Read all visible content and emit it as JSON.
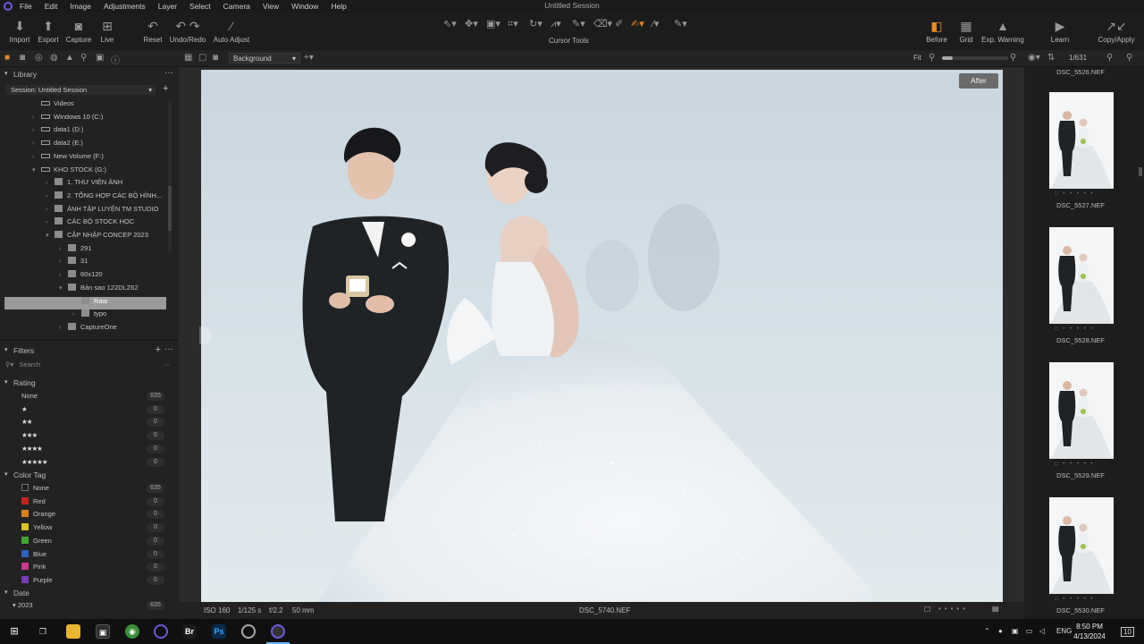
{
  "menu": [
    "File",
    "Edit",
    "Image",
    "Adjustments",
    "Layer",
    "Select",
    "Camera",
    "View",
    "Window",
    "Help"
  ],
  "window_title": "Untitled Session",
  "toolbar": {
    "import": "Import",
    "export": "Export",
    "capture": "Capture",
    "live": "Live",
    "reset": "Reset",
    "undo_redo": "Undo/Redo",
    "auto_adjust": "Auto Adjust",
    "cursor_tools": "Cursor Tools",
    "before": "Before",
    "grid": "Grid",
    "exp_warning": "Exp. Warning",
    "learn": "Learn",
    "copy_apply": "Copy/Apply"
  },
  "viewer_toolbar": {
    "background": "Background",
    "fit": "Fit",
    "counter": "1/631"
  },
  "library": {
    "title": "Library",
    "session": "Session: Untitled Session",
    "tree": [
      {
        "label": "Videos",
        "level": 0
      },
      {
        "label": "Windows 10 (C:)",
        "level": 0
      },
      {
        "label": "data1 (D:)",
        "level": 0
      },
      {
        "label": "data2 (E:)",
        "level": 0
      },
      {
        "label": "New Volume (F:)",
        "level": 0
      },
      {
        "label": "KHO STOCK (G:)",
        "level": 0
      },
      {
        "label": "1. THƯ VIỆN ẢNH",
        "level": 1
      },
      {
        "label": "2. TỔNG HỢP CÁC BỘ HÌNH...",
        "level": 1
      },
      {
        "label": "ẢNH TẬP LUYỆN TM STUDIO",
        "level": 1
      },
      {
        "label": "CÁC BỘ STOCK HỌC",
        "level": 1
      },
      {
        "label": "CẬP NHẬP CONCEP 2023",
        "level": 1
      },
      {
        "label": "291",
        "level": 2
      },
      {
        "label": "31",
        "level": 2
      },
      {
        "label": "60x120",
        "level": 2
      },
      {
        "label": "Bản sao 122DLZ62",
        "level": 2
      },
      {
        "label": "Raw",
        "level": 3
      },
      {
        "label": "typo",
        "level": 3
      },
      {
        "label": "CaptureOne",
        "level": 2
      }
    ]
  },
  "filters": {
    "title": "Filters",
    "search_placeholder": "Search",
    "rating_title": "Rating",
    "ratings": [
      {
        "label": "None",
        "count": "635"
      },
      {
        "label": "★",
        "count": "0"
      },
      {
        "label": "★★",
        "count": "0"
      },
      {
        "label": "★★★",
        "count": "0"
      },
      {
        "label": "★★★★",
        "count": "0"
      },
      {
        "label": "★★★★★",
        "count": "0"
      }
    ],
    "color_title": "Color Tag",
    "colors": [
      {
        "label": "None",
        "count": "635",
        "color": "#1e1e1e"
      },
      {
        "label": "Red",
        "count": "0",
        "color": "#c0281f"
      },
      {
        "label": "Orange",
        "count": "0",
        "color": "#d7801c"
      },
      {
        "label": "Yellow",
        "count": "0",
        "color": "#d8c51f"
      },
      {
        "label": "Green",
        "count": "0",
        "color": "#3fa52f"
      },
      {
        "label": "Blue",
        "count": "0",
        "color": "#2b62c2"
      },
      {
        "label": "Pink",
        "count": "0",
        "color": "#c8398f"
      },
      {
        "label": "Purple",
        "count": "0",
        "color": "#7a3cb5"
      }
    ],
    "date_title": "Date",
    "date_item": {
      "label": "2023",
      "count": "635"
    }
  },
  "viewer": {
    "after_label": "After"
  },
  "status": {
    "iso": "ISO 160",
    "shutter": "1/125 s",
    "aperture": "f/2.2",
    "focal": "50 mm",
    "filename": "DSC_5740.NEF"
  },
  "browser": {
    "top_name": "DSC_5526.NEF",
    "thumbs": [
      "DSC_5527.NEF",
      "DSC_5528.NEF",
      "DSC_5529.NEF",
      "DSC_5530.NEF"
    ]
  },
  "taskbar": {
    "apps": [
      "Br",
      "Ps"
    ],
    "lang": "ENG",
    "time": "8:50 PM",
    "date": "4/13/2024",
    "notif": "10"
  }
}
